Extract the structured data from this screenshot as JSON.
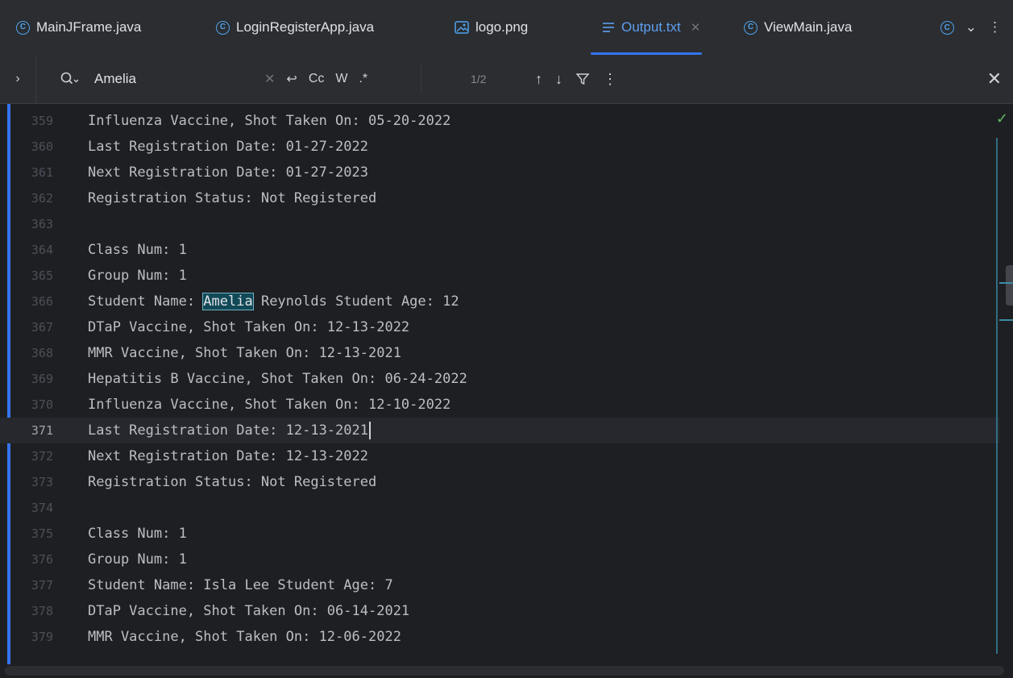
{
  "tabs": [
    {
      "label": "MainJFrame.java",
      "icon": "java-class-icon"
    },
    {
      "label": "LoginRegisterApp.java",
      "icon": "java-class-icon"
    },
    {
      "label": "logo.png",
      "icon": "image-file-icon"
    },
    {
      "label": "Output.txt",
      "icon": "text-file-icon",
      "active": true
    },
    {
      "label": "ViewMain.java",
      "icon": "java-class-icon"
    }
  ],
  "find": {
    "query": "Amelia",
    "count": "1/2",
    "opt_regex_word": "W",
    "opt_case": "Cc",
    "opt_regex": ".*"
  },
  "colors": {
    "accent": "#3574f0",
    "match_highlight": "#114957",
    "check_ok": "#5fb865"
  },
  "editor": {
    "current_line": "371",
    "lines": [
      {
        "num": "359",
        "text": "Influenza Vaccine, Shot Taken On: 05-20-2022"
      },
      {
        "num": "360",
        "text": "Last Registration Date: 01-27-2022"
      },
      {
        "num": "361",
        "text": "Next Registration Date: 01-27-2023"
      },
      {
        "num": "362",
        "text": "Registration Status: Not Registered"
      },
      {
        "num": "363",
        "text": ""
      },
      {
        "num": "364",
        "text": "Class Num: 1"
      },
      {
        "num": "365",
        "text": "Group Num: 1"
      },
      {
        "num": "366",
        "text_before": "Student Name: ",
        "match": "Amelia",
        "text_after": " Reynolds Student Age: 12"
      },
      {
        "num": "367",
        "text": "DTaP Vaccine, Shot Taken On: 12-13-2022"
      },
      {
        "num": "368",
        "text": "MMR Vaccine, Shot Taken On: 12-13-2021"
      },
      {
        "num": "369",
        "text": "Hepatitis B Vaccine, Shot Taken On: 06-24-2022"
      },
      {
        "num": "370",
        "text": "Influenza Vaccine, Shot Taken On: 12-10-2022"
      },
      {
        "num": "371",
        "text": "Last Registration Date: 12-13-2021"
      },
      {
        "num": "372",
        "text": "Next Registration Date: 12-13-2022"
      },
      {
        "num": "373",
        "text": "Registration Status: Not Registered"
      },
      {
        "num": "374",
        "text": ""
      },
      {
        "num": "375",
        "text": "Class Num: 1"
      },
      {
        "num": "376",
        "text": "Group Num: 1"
      },
      {
        "num": "377",
        "text": "Student Name: Isla Lee Student Age: 7"
      },
      {
        "num": "378",
        "text": "DTaP Vaccine, Shot Taken On: 06-14-2021"
      },
      {
        "num": "379",
        "text": "MMR Vaccine, Shot Taken On: 12-06-2022"
      }
    ]
  }
}
